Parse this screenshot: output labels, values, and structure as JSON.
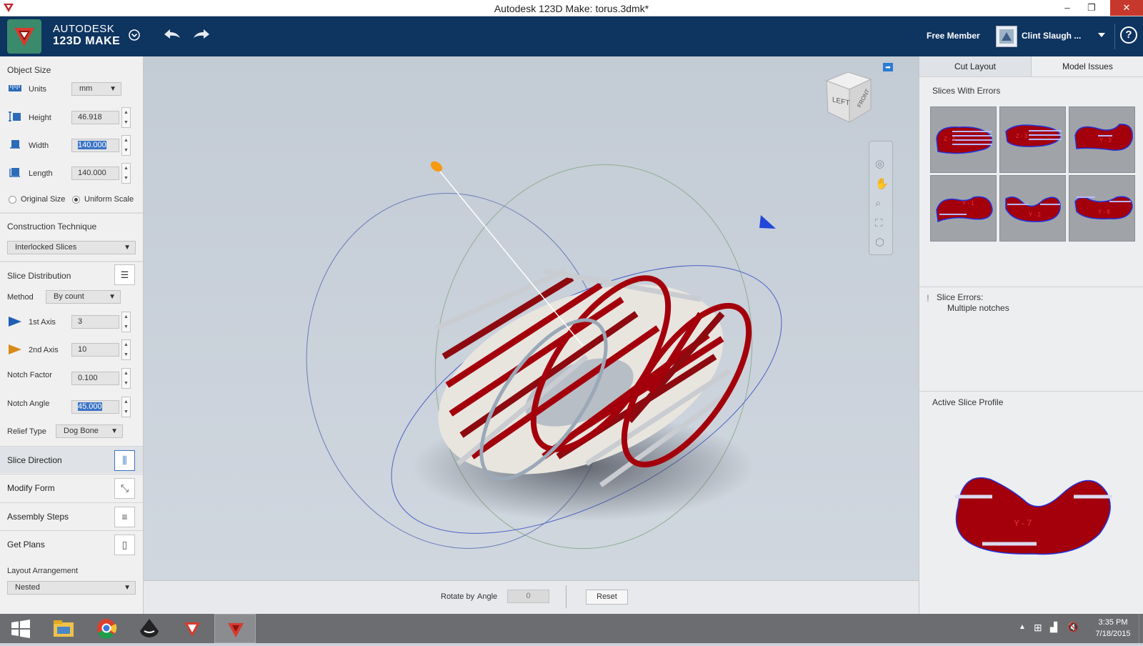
{
  "window": {
    "title": "Autodesk 123D Make: torus.3dmk*",
    "minimize": "–",
    "maximize": "❐",
    "close": "✕"
  },
  "header": {
    "brand_line1": "AUTODESK",
    "brand_line2": "123D MAKE",
    "member_label": "Free Member",
    "username": "Clint Slaugh ...",
    "help": "?"
  },
  "left": {
    "object_size": {
      "title": "Object Size",
      "units_label": "Units",
      "units_value": "mm",
      "height_label": "Height",
      "height_value": "46.918",
      "width_label": "Width",
      "width_value": "140.000",
      "length_label": "Length",
      "length_value": "140.000",
      "original_size": "Original Size",
      "uniform_scale": "Uniform Scale"
    },
    "construction": {
      "title": "Construction Technique",
      "value": "Interlocked Slices"
    },
    "distribution": {
      "title": "Slice Distribution",
      "method_label": "Method",
      "method_value": "By count",
      "axis1_label": "1st Axis",
      "axis1_value": "3",
      "axis2_label": "2nd Axis",
      "axis2_value": "10",
      "notch_factor_label": "Notch Factor",
      "notch_factor_value": "0.100",
      "notch_angle_label": "Notch Angle",
      "notch_angle_value": "45.000",
      "relief_label": "Relief Type",
      "relief_value": "Dog Bone"
    },
    "nav": [
      "Slice Direction",
      "Modify Form",
      "Assembly Steps",
      "Get Plans"
    ],
    "layout": {
      "label": "Layout Arrangement",
      "value": "Nested"
    }
  },
  "viewcube": {
    "left": "LEFT",
    "front": "FRONT"
  },
  "bottom": {
    "rotate_by": "Rotate by",
    "angle": "Angle",
    "angle_value": "0",
    "reset": "Reset"
  },
  "right": {
    "tabs": [
      "Cut Layout",
      "Model Issues"
    ],
    "slices_errors_title": "Slices With Errors",
    "thumb_labels": [
      "Z - 1",
      "Z - 3",
      "Y - 3",
      "Y - 1",
      "Y - 2",
      "Y - 8"
    ],
    "errors_title": "Slice Errors:",
    "errors_detail": "Multiple notches",
    "active_profile_title": "Active Slice Profile",
    "profile_label": "Y - 7"
  },
  "taskbar": {
    "time": "3:35 PM",
    "date": "7/18/2015"
  },
  "colors": {
    "header": "#0e3460",
    "slice_red": "#a3000c",
    "accent_blue": "#3b74c7"
  }
}
